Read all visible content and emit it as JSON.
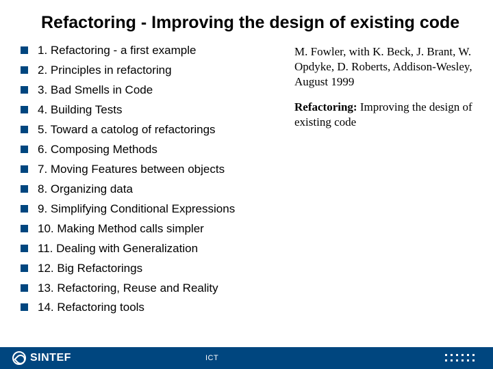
{
  "title": "Refactoring - Improving the design of existing code",
  "toc": [
    "1. Refactoring - a first example",
    "2. Principles in refactoring",
    "3. Bad Smells in Code",
    "4. Building Tests",
    "5. Toward a catolog of refactorings",
    "6. Composing Methods",
    "7. Moving Features between objects",
    "8. Organizing data",
    "9. Simplifying Conditional Expressions",
    "10. Making Method calls simpler",
    "11. Dealing with Generalization",
    "12. Big Refactorings",
    "13. Refactoring, Reuse and Reality",
    "14. Refactoring tools"
  ],
  "citation": "M. Fowler, with K. Beck, J. Brant, W. Opdyke, D. Roberts, Addison-Wesley, August 1999",
  "booktitle_bold": "Refactoring:",
  "booktitle_rest": " Improving the design of existing code",
  "footer": {
    "logo_text": "SINTEF",
    "center": "ICT"
  }
}
